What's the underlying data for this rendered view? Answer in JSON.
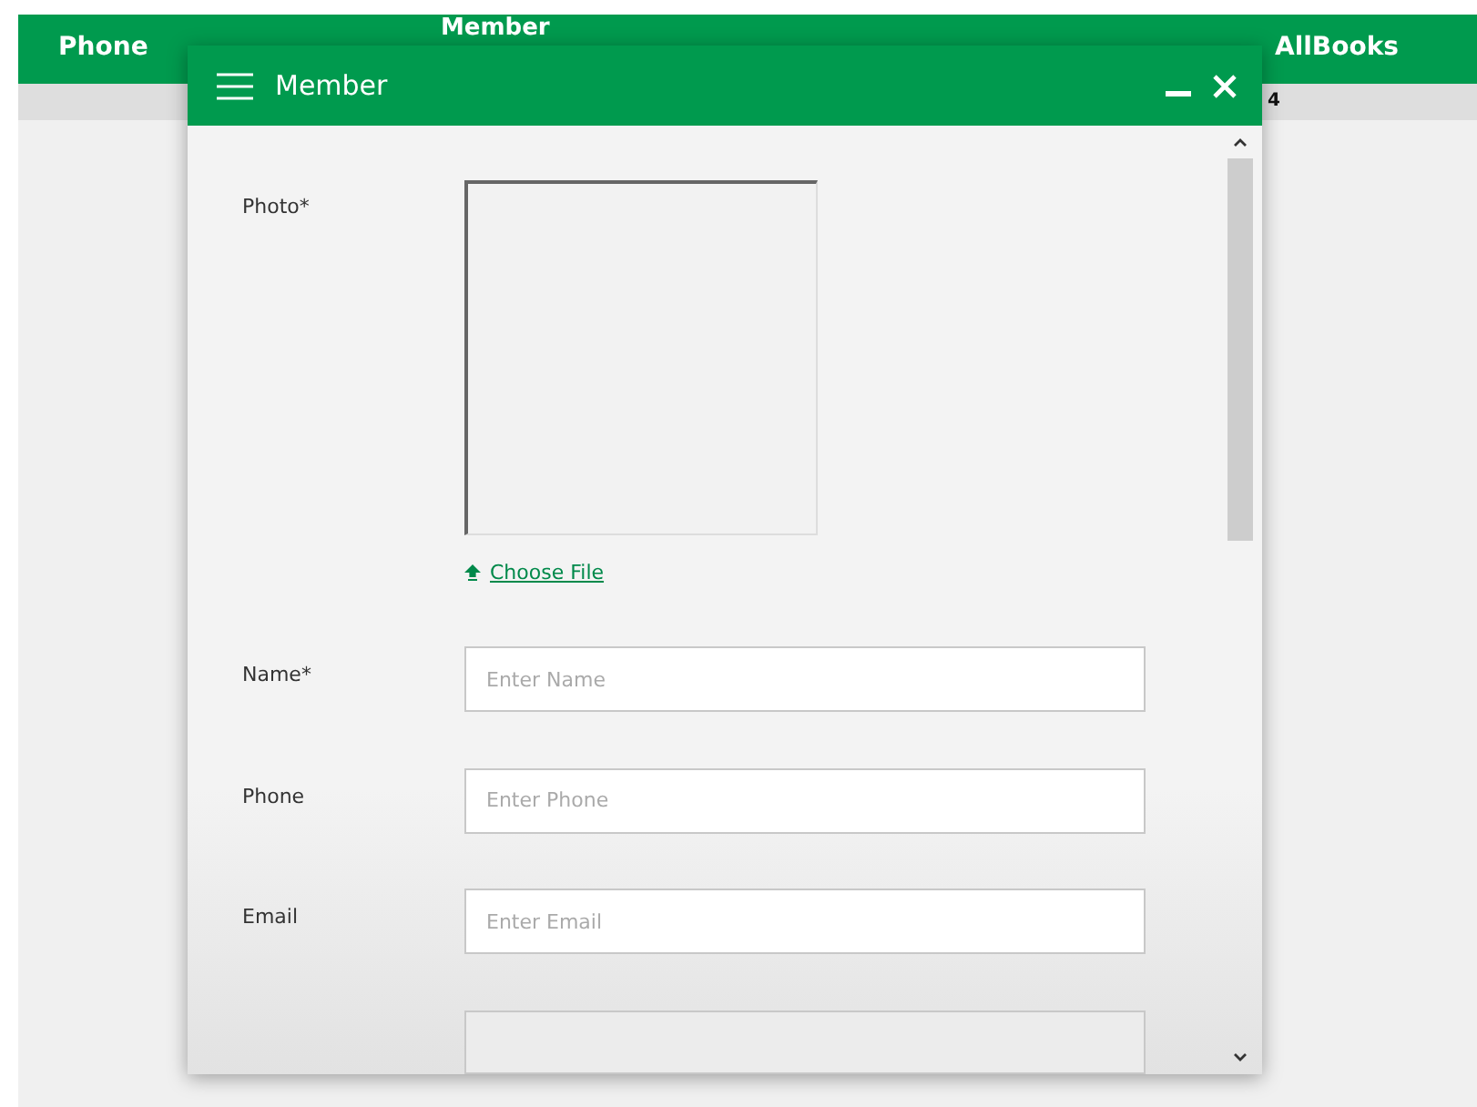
{
  "app_header": {
    "columns": [
      {
        "label": "Phone"
      },
      {
        "label": "Member"
      },
      {
        "label": "AllBooks"
      }
    ]
  },
  "table_row": {
    "cells": [
      "4"
    ]
  },
  "dialog": {
    "title": "Member",
    "photo": {
      "label": "Photo*",
      "link": "Choose File"
    },
    "fields": [
      {
        "kind": "input",
        "label": "Name*",
        "placeholder": "Enter Name"
      },
      {
        "kind": "input",
        "label": "Phone",
        "placeholder": "Enter Phone"
      },
      {
        "kind": "input",
        "label": "Email",
        "placeholder": "Enter Email"
      },
      {
        "kind": "cut"
      }
    ]
  }
}
